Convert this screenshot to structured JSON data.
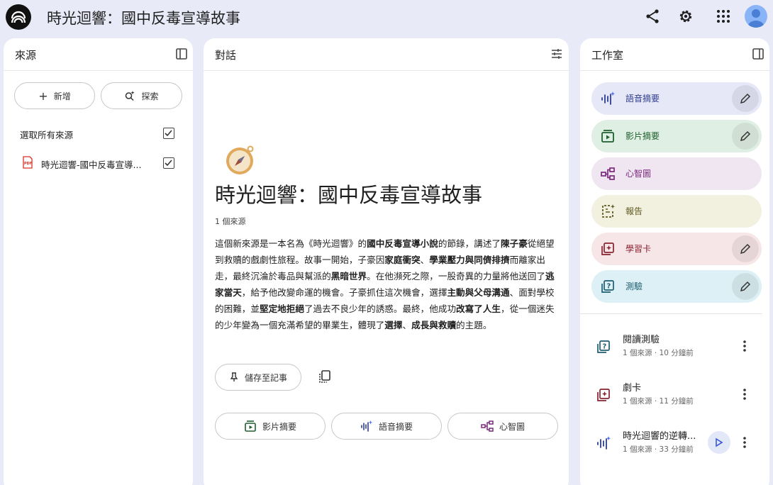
{
  "header": {
    "title": "時光迴響：國中反毒宣導故事"
  },
  "sources": {
    "title": "來源",
    "add_label": "新增",
    "explore_label": "探索",
    "select_all_label": "選取所有來源",
    "items": [
      {
        "icon": "pdf-icon",
        "label": "時光迴響-國中反毒宣導...",
        "checked": true
      }
    ]
  },
  "chat": {
    "title": "對話",
    "notebook_title": "時光迴響：國中反毒宣導故事",
    "source_count": "1 個來源",
    "summary": [
      {
        "t": "這個新來源是一本名為《時光迴響》的"
      },
      {
        "t": "國中反毒宣導小說",
        "b": true
      },
      {
        "t": "的節錄，講述了"
      },
      {
        "t": "陳子豪",
        "b": true
      },
      {
        "t": "從絕望到救贖的戲劇性旅程。故事一開始，子豪因"
      },
      {
        "t": "家庭衝突",
        "b": true
      },
      {
        "t": "、"
      },
      {
        "t": "學業壓力與同儕排擠",
        "b": true
      },
      {
        "t": "而離家出走，最終沉淪於毒品與幫派的"
      },
      {
        "t": "黑暗世界",
        "b": true
      },
      {
        "t": "。在他瀕死之際，一股奇異的力量將他送回了"
      },
      {
        "t": "逃家當天",
        "b": true
      },
      {
        "t": "，給予他改變命運的機會。子豪抓住這次機會，選擇"
      },
      {
        "t": "主動與父母溝通",
        "b": true
      },
      {
        "t": "、面對學校的困難，並"
      },
      {
        "t": "堅定地拒絕",
        "b": true
      },
      {
        "t": "了過去不良少年的誘惑。最終，他成功"
      },
      {
        "t": "改寫了人生",
        "b": true
      },
      {
        "t": "，從一個迷失的少年變為一個充滿希望的畢業生，體現了"
      },
      {
        "t": "選擇",
        "b": true
      },
      {
        "t": "、"
      },
      {
        "t": "成長與救贖",
        "b": true
      },
      {
        "t": "的主題。"
      }
    ],
    "save_label": "儲存至記事",
    "chips": [
      "影片摘要",
      "語音摘要",
      "心智圖"
    ]
  },
  "studio": {
    "title": "工作室",
    "cards": [
      {
        "label": "語音摘要",
        "icon": "audio-waveform-icon",
        "bg": "#e6e8f8",
        "fg": "#2f3d8f",
        "editable": true
      },
      {
        "label": "影片摘要",
        "icon": "video-play-icon",
        "bg": "#e0efe3",
        "fg": "#1e5f2e",
        "editable": true
      },
      {
        "label": "心智圖",
        "icon": "mindmap-icon",
        "bg": "#f0e6f1",
        "fg": "#7a2a7e",
        "editable": false
      },
      {
        "label": "報告",
        "icon": "report-icon",
        "bg": "#f2f0df",
        "fg": "#5e5a20",
        "editable": false
      },
      {
        "label": "學習卡",
        "icon": "flashcard-icon",
        "bg": "#f7e6e8",
        "fg": "#8a2230",
        "editable": true
      },
      {
        "label": "測驗",
        "icon": "quiz-icon",
        "bg": "#dcf0f5",
        "fg": "#1e5e72",
        "editable": true
      }
    ],
    "notes": [
      {
        "title": "閱讀測驗",
        "meta": "1 個來源 · 10 分鐘前",
        "icon": "quiz-icon",
        "color": "#1e5e72",
        "playable": false
      },
      {
        "title": "劇卡",
        "meta": "1 個來源 · 11 分鐘前",
        "icon": "flashcard-icon",
        "color": "#8a2230",
        "playable": false
      },
      {
        "title": "時光迴響的逆轉...",
        "meta": "1 個來源 · 33 分鐘前",
        "icon": "audio-waveform-icon",
        "color": "#2f3d8f",
        "playable": true
      }
    ]
  }
}
